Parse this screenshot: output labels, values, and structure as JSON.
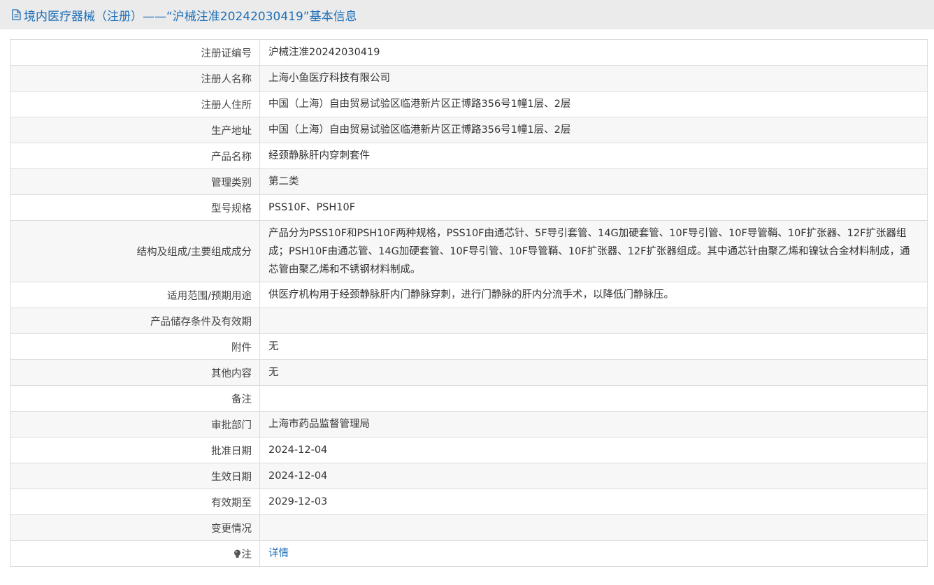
{
  "header": {
    "title": "境内医疗器械（注册）——“沪械注准20242030419”基本信息",
    "icon": "document-icon",
    "color": "#1e6fb8"
  },
  "rows": [
    {
      "label": "注册证编号",
      "value": "沪械注准20242030419"
    },
    {
      "label": "注册人名称",
      "value": "上海小鱼医疗科技有限公司"
    },
    {
      "label": "注册人住所",
      "value": "中国（上海）自由贸易试验区临港新片区正博路356号1幢1层、2层"
    },
    {
      "label": "生产地址",
      "value": "中国（上海）自由贸易试验区临港新片区正博路356号1幢1层、2层"
    },
    {
      "label": "产品名称",
      "value": "经颈静脉肝内穿刺套件"
    },
    {
      "label": "管理类别",
      "value": "第二类"
    },
    {
      "label": "型号规格",
      "value": "PSS10F、PSH10F"
    },
    {
      "label": "结构及组成/主要组成成分",
      "value": "产品分为PSS10F和PSH10F两种规格，PSS10F由通芯针、5F导引套管、14G加硬套管、10F导引管、10F导管鞘、10F扩张器、12F扩张器组成；PSH10F由通芯管、14G加硬套管、10F导引管、10F导管鞘、10F扩张器、12F扩张器组成。其中通芯针由聚乙烯和镍钛合金材料制成，通芯管由聚乙烯和不锈钢材料制成。"
    },
    {
      "label": "适用范围/预期用途",
      "value": "供医疗机构用于经颈静脉肝内门静脉穿刺，进行门静脉的肝内分流手术，以降低门静脉压。"
    },
    {
      "label": "产品储存条件及有效期",
      "value": ""
    },
    {
      "label": "附件",
      "value": "无"
    },
    {
      "label": "其他内容",
      "value": "无"
    },
    {
      "label": "备注",
      "value": ""
    },
    {
      "label": "审批部门",
      "value": "上海市药品监督管理局"
    },
    {
      "label": "批准日期",
      "value": "2024-12-04"
    },
    {
      "label": "生效日期",
      "value": "2024-12-04"
    },
    {
      "label": "有效期至",
      "value": "2029-12-03"
    },
    {
      "label": "变更情况",
      "value": ""
    }
  ],
  "note_row": {
    "label": "注",
    "icon": "lightbulb-icon",
    "link_text": "详情"
  }
}
